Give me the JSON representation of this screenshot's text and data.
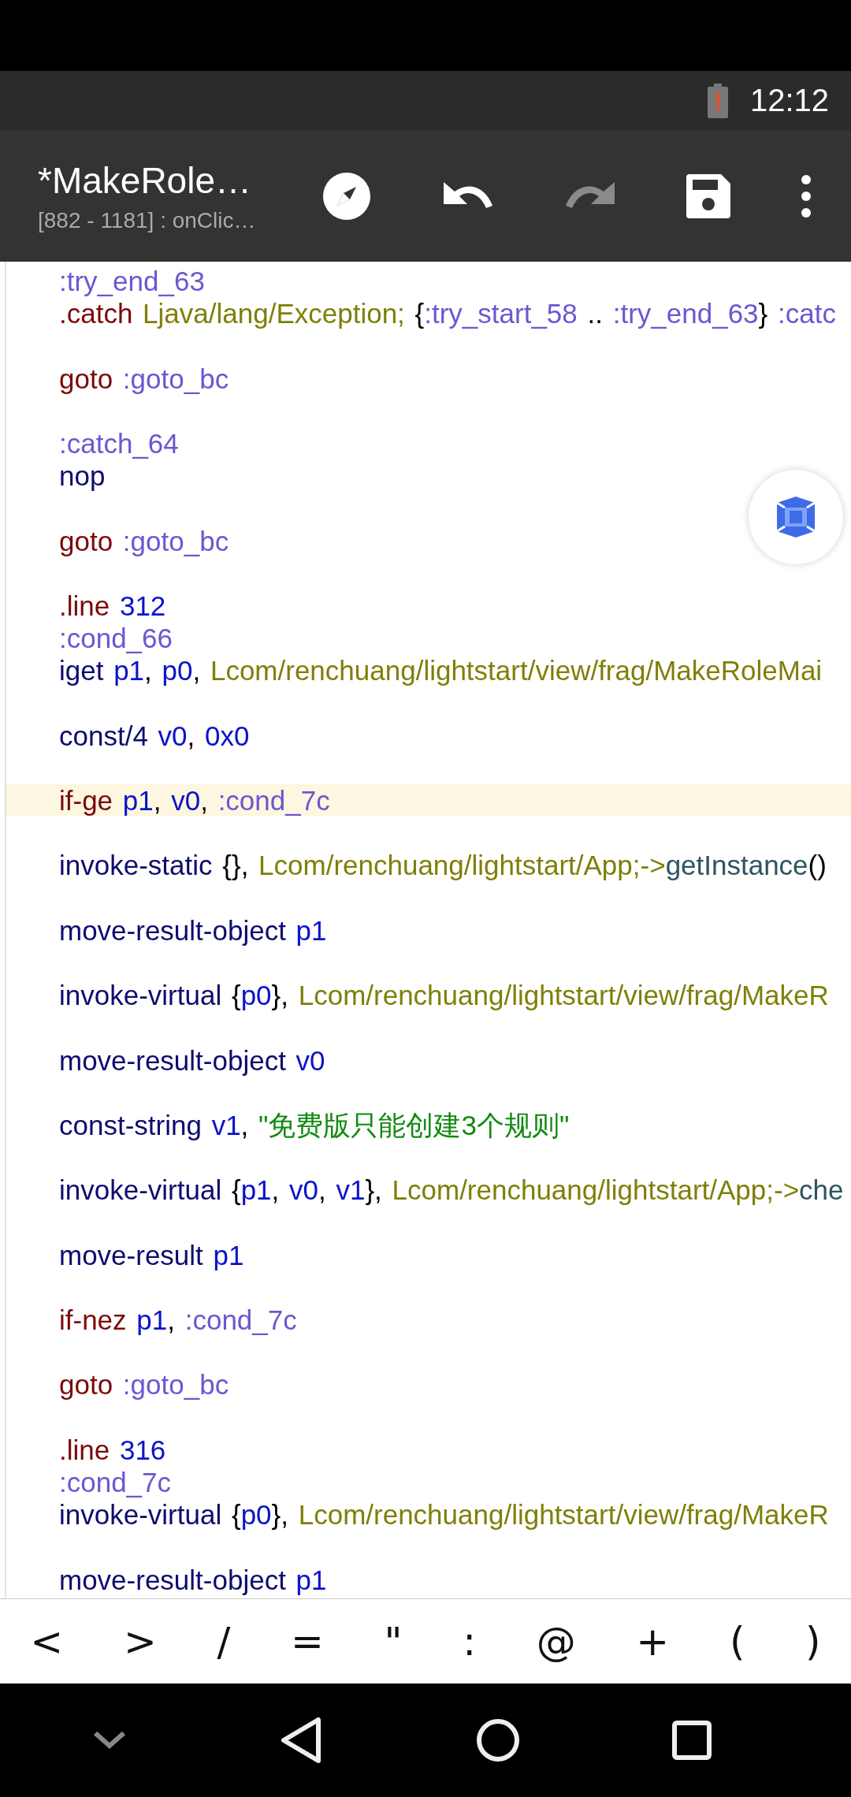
{
  "status_bar": {
    "time": "12:12",
    "battery_warning": true
  },
  "toolbar": {
    "title": "*MakeRole…",
    "subtitle": "[882 - 1181] : onClic…",
    "actions": [
      {
        "kind": "compass",
        "disabled": false
      },
      {
        "kind": "undo",
        "disabled": false
      },
      {
        "kind": "redo",
        "disabled": true
      },
      {
        "kind": "save",
        "disabled": false
      },
      {
        "kind": "more",
        "disabled": false
      }
    ]
  },
  "code": [
    {
      "kind": "code",
      "current": false,
      "tokens": [
        {
          "kind": "label",
          "t": ":try_end_63"
        }
      ]
    },
    {
      "kind": "code",
      "current": false,
      "tokens": [
        {
          "kind": "dir",
          "t": ".catch "
        },
        {
          "kind": "type",
          "t": "Ljava/lang/Exception; "
        },
        {
          "kind": "punct",
          "t": "{"
        },
        {
          "kind": "label",
          "t": ":try_start_58"
        },
        {
          "kind": "punct",
          "t": " .. "
        },
        {
          "kind": "label",
          "t": ":try_end_63"
        },
        {
          "kind": "punct",
          "t": "} "
        },
        {
          "kind": "label",
          "t": ":catc"
        }
      ]
    },
    {
      "kind": "blank"
    },
    {
      "kind": "code",
      "current": false,
      "tokens": [
        {
          "kind": "dir",
          "t": "goto "
        },
        {
          "kind": "label",
          "t": ":goto_bc"
        }
      ]
    },
    {
      "kind": "blank"
    },
    {
      "kind": "code",
      "current": false,
      "tokens": [
        {
          "kind": "label",
          "t": ":catch_64"
        }
      ]
    },
    {
      "kind": "code",
      "current": false,
      "tokens": [
        {
          "kind": "kw",
          "t": "nop"
        }
      ]
    },
    {
      "kind": "blank"
    },
    {
      "kind": "code",
      "current": false,
      "tokens": [
        {
          "kind": "dir",
          "t": "goto "
        },
        {
          "kind": "label",
          "t": ":goto_bc"
        }
      ]
    },
    {
      "kind": "blank"
    },
    {
      "kind": "code",
      "current": false,
      "tokens": [
        {
          "kind": "dir",
          "t": ".line "
        },
        {
          "kind": "num",
          "t": "312"
        }
      ]
    },
    {
      "kind": "code",
      "current": false,
      "tokens": [
        {
          "kind": "label",
          "t": ":cond_66"
        }
      ]
    },
    {
      "kind": "code",
      "current": false,
      "tokens": [
        {
          "kind": "kw",
          "t": "iget "
        },
        {
          "kind": "reg",
          "t": "p1"
        },
        {
          "kind": "punct",
          "t": ", "
        },
        {
          "kind": "reg",
          "t": "p0"
        },
        {
          "kind": "punct",
          "t": ", "
        },
        {
          "kind": "type",
          "t": "Lcom/renchuang/lightstart/view/frag/MakeRoleMai"
        }
      ]
    },
    {
      "kind": "blank"
    },
    {
      "kind": "code",
      "current": false,
      "tokens": [
        {
          "kind": "kw",
          "t": "const/4 "
        },
        {
          "kind": "reg",
          "t": "v0"
        },
        {
          "kind": "punct",
          "t": ", "
        },
        {
          "kind": "num",
          "t": "0x0"
        }
      ]
    },
    {
      "kind": "blank"
    },
    {
      "kind": "code",
      "current": true,
      "tokens": [
        {
          "kind": "dir",
          "t": "if-ge "
        },
        {
          "kind": "reg",
          "t": "p1"
        },
        {
          "kind": "punct",
          "t": ", "
        },
        {
          "kind": "reg",
          "t": "v0"
        },
        {
          "kind": "punct",
          "t": ", "
        },
        {
          "kind": "label",
          "t": ":cond_7c"
        }
      ]
    },
    {
      "kind": "blank"
    },
    {
      "kind": "code",
      "current": false,
      "tokens": [
        {
          "kind": "kw",
          "t": "invoke-static "
        },
        {
          "kind": "punct",
          "t": "{}, "
        },
        {
          "kind": "type",
          "t": "Lcom/renchuang/lightstart/App;->"
        },
        {
          "kind": "method",
          "t": "getInstance"
        },
        {
          "kind": "punct",
          "t": "()"
        }
      ]
    },
    {
      "kind": "blank"
    },
    {
      "kind": "code",
      "current": false,
      "tokens": [
        {
          "kind": "kw",
          "t": "move-result-object "
        },
        {
          "kind": "reg",
          "t": "p1"
        }
      ]
    },
    {
      "kind": "blank"
    },
    {
      "kind": "code",
      "current": false,
      "tokens": [
        {
          "kind": "kw",
          "t": "invoke-virtual "
        },
        {
          "kind": "punct",
          "t": "{"
        },
        {
          "kind": "reg",
          "t": "p0"
        },
        {
          "kind": "punct",
          "t": "}, "
        },
        {
          "kind": "type",
          "t": "Lcom/renchuang/lightstart/view/frag/MakeR"
        }
      ]
    },
    {
      "kind": "blank"
    },
    {
      "kind": "code",
      "current": false,
      "tokens": [
        {
          "kind": "kw",
          "t": "move-result-object "
        },
        {
          "kind": "reg",
          "t": "v0"
        }
      ]
    },
    {
      "kind": "blank"
    },
    {
      "kind": "code",
      "current": false,
      "tokens": [
        {
          "kind": "kw",
          "t": "const-string "
        },
        {
          "kind": "reg",
          "t": "v1"
        },
        {
          "kind": "punct",
          "t": ", "
        },
        {
          "kind": "str",
          "t": "\"免费版只能创建3个规则\""
        }
      ]
    },
    {
      "kind": "blank"
    },
    {
      "kind": "code",
      "current": false,
      "tokens": [
        {
          "kind": "kw",
          "t": "invoke-virtual "
        },
        {
          "kind": "punct",
          "t": "{"
        },
        {
          "kind": "reg",
          "t": "p1"
        },
        {
          "kind": "punct",
          "t": ", "
        },
        {
          "kind": "reg",
          "t": "v0"
        },
        {
          "kind": "punct",
          "t": ", "
        },
        {
          "kind": "reg",
          "t": "v1"
        },
        {
          "kind": "punct",
          "t": "}, "
        },
        {
          "kind": "type",
          "t": "Lcom/renchuang/lightstart/App;->"
        },
        {
          "kind": "method",
          "t": "che"
        }
      ]
    },
    {
      "kind": "blank"
    },
    {
      "kind": "code",
      "current": false,
      "tokens": [
        {
          "kind": "kw",
          "t": "move-result "
        },
        {
          "kind": "reg",
          "t": "p1"
        }
      ]
    },
    {
      "kind": "blank"
    },
    {
      "kind": "code",
      "current": false,
      "tokens": [
        {
          "kind": "dir",
          "t": "if-nez "
        },
        {
          "kind": "reg",
          "t": "p1"
        },
        {
          "kind": "punct",
          "t": ", "
        },
        {
          "kind": "label",
          "t": ":cond_7c"
        }
      ]
    },
    {
      "kind": "blank"
    },
    {
      "kind": "code",
      "current": false,
      "tokens": [
        {
          "kind": "dir",
          "t": "goto "
        },
        {
          "kind": "label",
          "t": ":goto_bc"
        }
      ]
    },
    {
      "kind": "blank"
    },
    {
      "kind": "code",
      "current": false,
      "tokens": [
        {
          "kind": "dir",
          "t": ".line "
        },
        {
          "kind": "num",
          "t": "316"
        }
      ]
    },
    {
      "kind": "code",
      "current": false,
      "tokens": [
        {
          "kind": "label",
          "t": ":cond_7c"
        }
      ]
    },
    {
      "kind": "code",
      "current": false,
      "tokens": [
        {
          "kind": "kw",
          "t": "invoke-virtual "
        },
        {
          "kind": "punct",
          "t": "{"
        },
        {
          "kind": "reg",
          "t": "p0"
        },
        {
          "kind": "punct",
          "t": "}, "
        },
        {
          "kind": "type",
          "t": "Lcom/renchuang/lightstart/view/frag/MakeR"
        }
      ]
    },
    {
      "kind": "blank"
    },
    {
      "kind": "code",
      "current": false,
      "tokens": [
        {
          "kind": "kw",
          "t": "move-result-object "
        },
        {
          "kind": "reg",
          "t": "p1"
        }
      ]
    }
  ],
  "symbol_keys": [
    "<",
    ">",
    "/",
    "=",
    "\"",
    ":",
    "@",
    "+",
    "(",
    ")"
  ],
  "nav_bar": [
    {
      "kind": "hide"
    },
    {
      "kind": "back"
    },
    {
      "kind": "home"
    },
    {
      "kind": "recents"
    }
  ]
}
